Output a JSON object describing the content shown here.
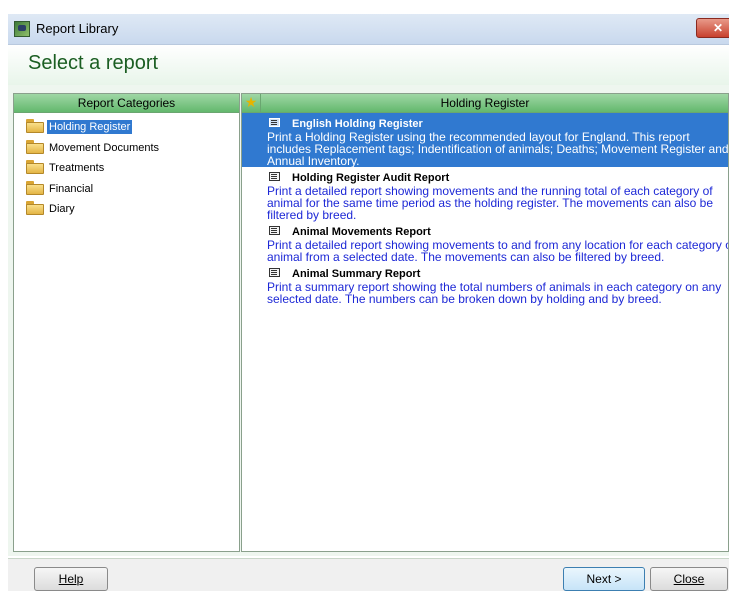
{
  "window": {
    "title": "Report Library",
    "close_label": "✕"
  },
  "header": {
    "heading": "Select a report"
  },
  "categories": {
    "header": "Report Categories",
    "items": [
      {
        "label": "Holding Register",
        "selected": true
      },
      {
        "label": "Movement Documents"
      },
      {
        "label": "Treatments"
      },
      {
        "label": "Financial"
      },
      {
        "label": "Diary"
      }
    ]
  },
  "reports": {
    "header": "Holding Register",
    "items": [
      {
        "title": "English Holding Register",
        "description": "Print a Holding Register using the recommended layout for England. This report includes Replacement tags; Indentification of animals; Deaths; Movement Register and Annual Inventory.",
        "selected": true
      },
      {
        "title": "Holding Register Audit Report",
        "description": "Print a detailed report showing movements and the running total of each category of animal for the same time period as the holding register. The movements can also be filtered by breed."
      },
      {
        "title": "Animal Movements Report",
        "description": "Print a detailed report showing movements to and from any location for each category of animal from a selected date. The movements can also be filtered by breed."
      },
      {
        "title": "Animal Summary Report",
        "description": "Print a summary report showing the total numbers of animals in each category on any selected date. The numbers can be broken down by holding and by breed."
      }
    ]
  },
  "footer": {
    "help_label": "Help",
    "next_label": "Next >",
    "close_label": "Close"
  }
}
